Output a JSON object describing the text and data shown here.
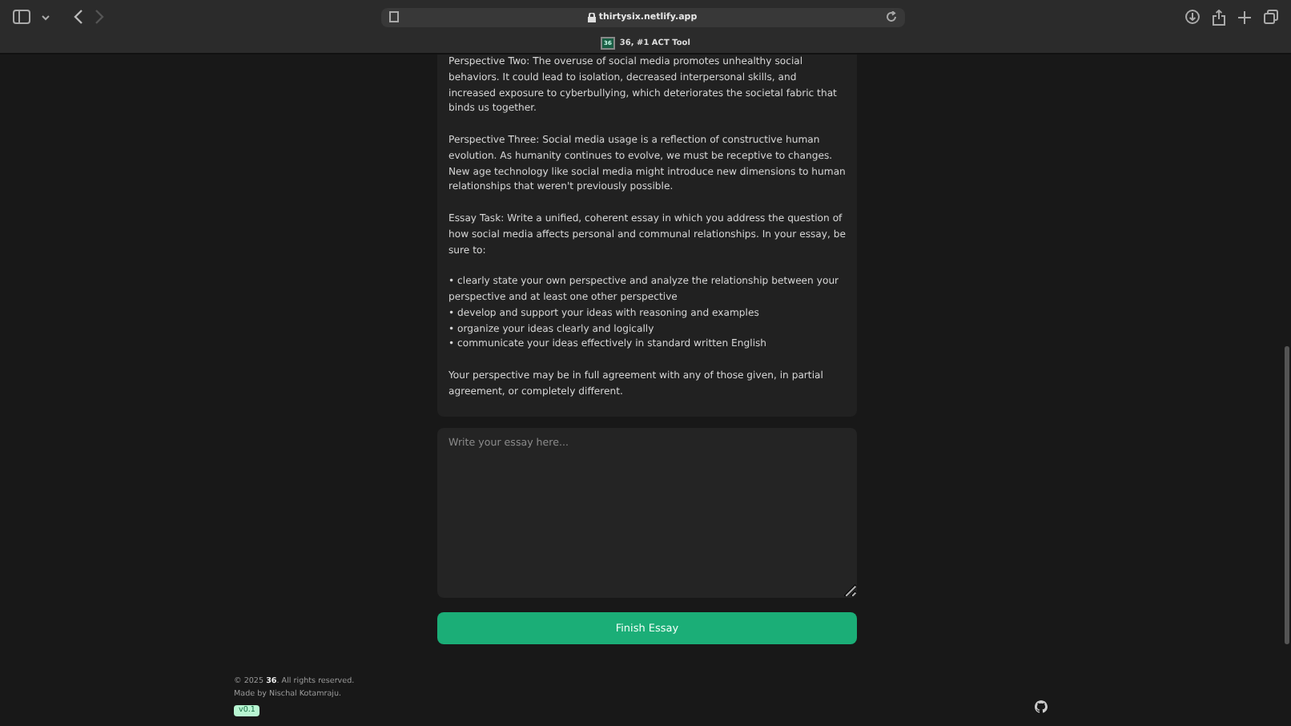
{
  "browser": {
    "address": "thirtysix.netlify.app",
    "tab_title": "36, #1 ACT Tool",
    "tab_favicon": "36"
  },
  "prompt": {
    "paragraphs": [
      "Perspective Two: The overuse of social media promotes unhealthy social behaviors. It could lead to isolation, decreased interpersonal skills, and increased exposure to cyberbullying, which deteriorates the societal fabric that binds us together.",
      "Perspective Three: Social media usage is a reflection of constructive human evolution. As humanity continues to evolve, we must be receptive to changes. New age technology like social media might introduce new dimensions to human relationships that weren't previously possible.",
      "Essay Task: Write a unified, coherent essay in which you address the question of how social media affects personal and communal relationships. In your essay, be sure to:",
      "• clearly state your own perspective and analyze the relationship between your perspective and at least one other perspective\n• develop and support your ideas with reasoning and examples\n• organize your ideas clearly and logically\n• communicate your ideas effectively in standard written English",
      "Your perspective may be in full agreement with any of those given, in partial agreement, or completely different."
    ]
  },
  "essay": {
    "placeholder": "Write your essay here..."
  },
  "finish_button": "Finish Essay",
  "footer": {
    "copyright": "© 2025 **36**. All rights reserved.",
    "credit": "Made by Nischal Kotamraju.",
    "version": "v0.1"
  }
}
